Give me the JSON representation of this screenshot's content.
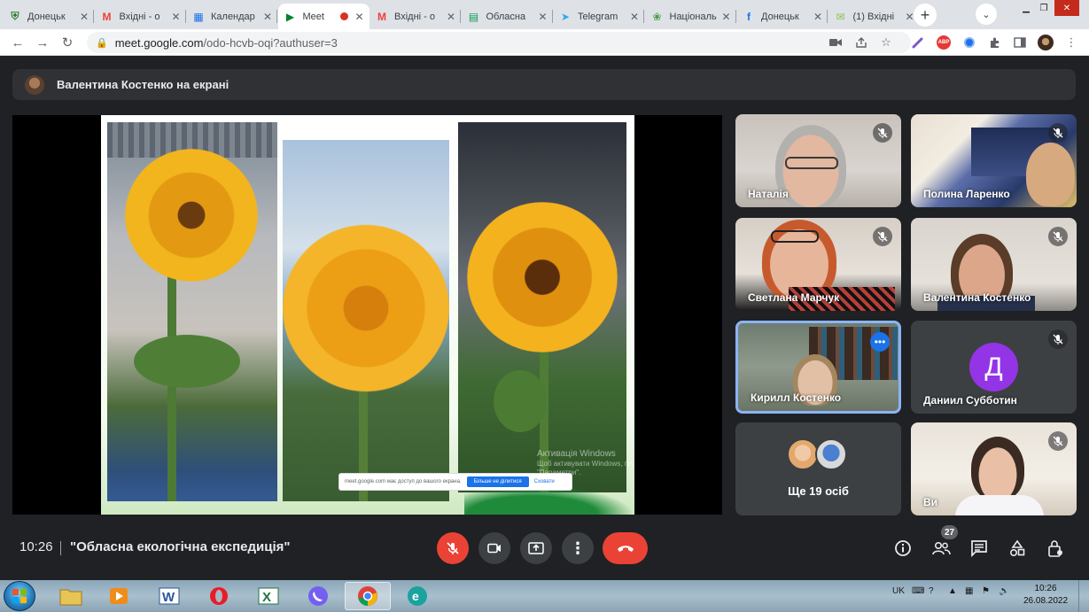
{
  "browser": {
    "tabs": [
      {
        "title": "Донецьк",
        "icon": "donetsk-shield-icon",
        "color": "#2e7d32"
      },
      {
        "title": "Вхідні - о",
        "icon": "gmail-icon",
        "color": "#ea4335"
      },
      {
        "title": "Календар",
        "icon": "calendar-icon",
        "color": "#1a73e8"
      },
      {
        "title": "Meet",
        "icon": "meet-icon",
        "color": "#00832d",
        "active": true,
        "recording": true
      },
      {
        "title": "Вхідні - о",
        "icon": "gmail-icon",
        "color": "#ea4335"
      },
      {
        "title": "Обласна",
        "icon": "sheets-icon",
        "color": "#0f9d58"
      },
      {
        "title": "Telegram",
        "icon": "telegram-icon",
        "color": "#2aabee"
      },
      {
        "title": "Національ",
        "icon": "national-emblem-icon",
        "color": "#43a047"
      },
      {
        "title": "Донецьк",
        "icon": "facebook-icon",
        "color": "#1877f2"
      },
      {
        "title": "(1) Вхідні",
        "icon": "mail-bag-icon",
        "color": "#8bc34a"
      }
    ],
    "url_host": "meet.google.com",
    "url_path": "/odo-hcvb-oqi?authuser=3",
    "extensions": {
      "adblock": "ABP"
    }
  },
  "meet": {
    "presenter_banner": "Валентина Костенко на екрані",
    "share_note": {
      "text": "meet.google.com має доступ до вашого екрана.",
      "stop_label": "Більше не ділитися",
      "hide_label": "Сховати"
    },
    "windows_activation": {
      "title": "Активація Windows",
      "line": "Щоб активувати Windows, перейдіть в розділ \"Параметри\"."
    },
    "participants": [
      {
        "name": "Наталія",
        "muted": true
      },
      {
        "name": "Полина Ларенко",
        "muted": true
      },
      {
        "name": "Светлана Марчук",
        "muted": true
      },
      {
        "name": "Валентина Костенко",
        "muted": true
      },
      {
        "name": "Кирилл Костенко",
        "speaking": true
      },
      {
        "name": "Даниил Субботин",
        "muted": true,
        "initial": "Д",
        "avatar_color": "#9334e6"
      },
      {
        "name": "Ви",
        "muted": true
      }
    ],
    "more_people": "Ще 19 осіб",
    "time": "10:26",
    "meeting_title": "\"Обласна екологічна експедиція\"",
    "participant_count": "27"
  },
  "taskbar": {
    "lang": "UK",
    "time": "10:26",
    "date": "26.08.2022"
  }
}
